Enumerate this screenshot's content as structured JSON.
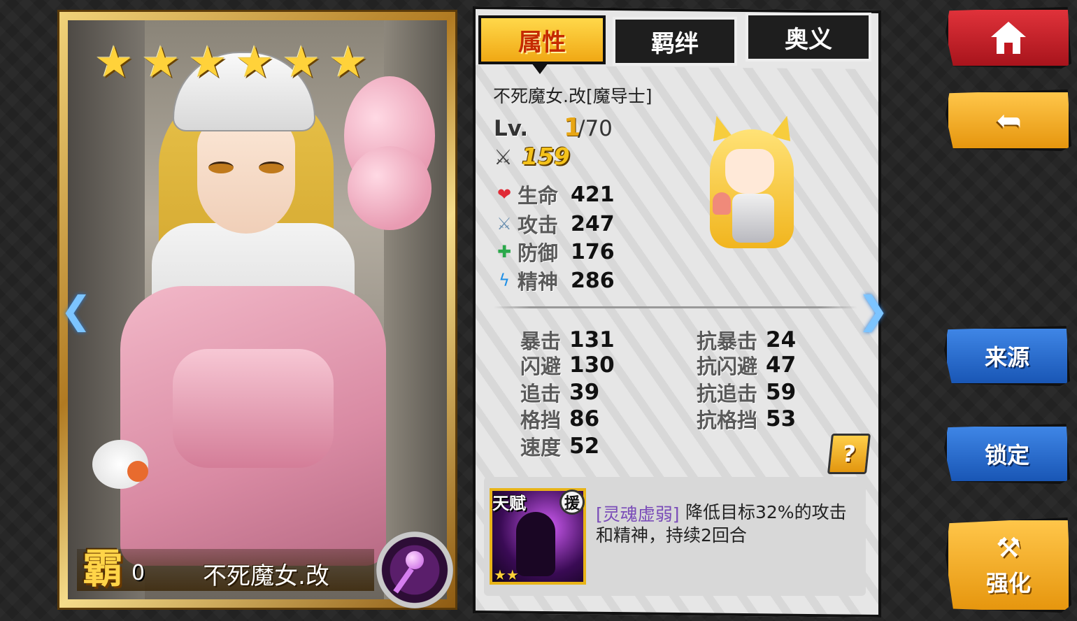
{
  "card": {
    "stars": 6,
    "name": "不死魔女.改",
    "ba_label": "霸",
    "ba_value": "0",
    "class_icon": "magic-staff-icon"
  },
  "tabs": {
    "attributes": "属性",
    "bonds": "羁绊",
    "mystery": "奥义"
  },
  "hero": {
    "full_name": "不死魔女.改[魔导士]",
    "level_label": "Lv.",
    "level": "1",
    "level_max": "/70",
    "power": "159"
  },
  "stats": {
    "hp": {
      "label": "生命",
      "value": "421"
    },
    "atk": {
      "label": "攻击",
      "value": "247"
    },
    "def": {
      "label": "防御",
      "value": "176"
    },
    "spirit": {
      "label": "精神",
      "value": "286"
    }
  },
  "sub_stats": {
    "crit": {
      "label": "暴击",
      "value": "131"
    },
    "dodge": {
      "label": "闪避",
      "value": "130"
    },
    "chase": {
      "label": "追击",
      "value": "39"
    },
    "block": {
      "label": "格挡",
      "value": "86"
    },
    "speed": {
      "label": "速度",
      "value": "52"
    },
    "anti_crit": {
      "label": "抗暴击",
      "value": "24"
    },
    "anti_dodge": {
      "label": "抗闪避",
      "value": "47"
    },
    "anti_chase": {
      "label": "抗追击",
      "value": "59"
    },
    "anti_block": {
      "label": "抗格挡",
      "value": "53"
    }
  },
  "help_label": "?",
  "talent": {
    "tag": "天赋",
    "assist": "援",
    "stars": "★★",
    "name": "[灵魂虚弱]",
    "description": "降低目标32%的攻击和精神，持续2回合"
  },
  "buttons": {
    "source": "来源",
    "lock": "锁定",
    "enhance": "强化"
  },
  "nav": {
    "prev": "❮",
    "next": "❯"
  }
}
